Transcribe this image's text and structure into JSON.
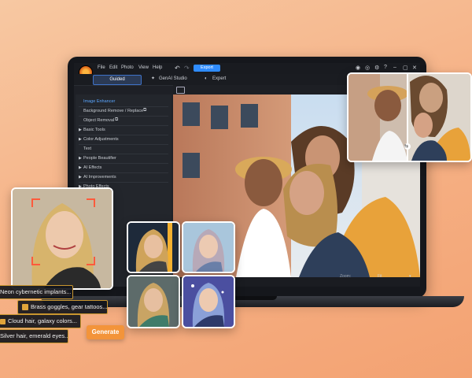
{
  "menu": {
    "file": "File",
    "edit": "Edit",
    "photo": "Photo",
    "view": "View",
    "help": "Help",
    "undo": "↶",
    "redo": "↷",
    "export": "Export"
  },
  "modes": {
    "guided": "Guided",
    "genai": "GenAI Studio",
    "expert": "Expert"
  },
  "sidebar": {
    "items": [
      {
        "label": "Image Enhancer",
        "selected": true,
        "expandable": false
      },
      {
        "label": "Background Remove / Replace",
        "expandable": false
      },
      {
        "label": "Object Removal",
        "expandable": false
      },
      {
        "label": "Basic Tools",
        "expandable": true
      },
      {
        "label": "Color Adjustments",
        "expandable": true
      },
      {
        "label": "Text",
        "expandable": false
      },
      {
        "label": "People Beautifier",
        "expandable": true
      },
      {
        "label": "AI Effects",
        "expandable": true
      },
      {
        "label": "AI Improvements",
        "expandable": true
      },
      {
        "label": "Photo Effects",
        "expandable": true
      }
    ]
  },
  "status": {
    "zoom_label": "Zoom:",
    "zoom_value": "Fit"
  },
  "prompts": [
    "Neon cybernetic implants...",
    "Brass goggles, gear tattoos...",
    "Cloud hair, galaxy colors...",
    "Silver hair, emerald eyes..."
  ],
  "generate_label": "Generate",
  "colors": {
    "accent": "#2f8cff",
    "generate": "#f3943a",
    "prompt_border": "#c9962f",
    "background": "#f6b388"
  }
}
